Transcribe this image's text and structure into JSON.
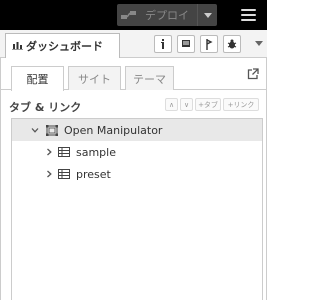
{
  "header": {
    "deploy_label": "デプロイ",
    "menu_icon": "hamburger-menu-icon"
  },
  "sidebar_tabs": {
    "dashboard_label": "ダッシュボード",
    "icons": [
      "info-icon",
      "book-icon",
      "debug-icon",
      "bug-icon",
      "chart-icon"
    ]
  },
  "dashboard": {
    "subtabs": [
      "配置",
      "サイト",
      "テーマ"
    ],
    "section_title": "タブ & リンク",
    "buttons": {
      "collapse": "∧",
      "expand": "∨",
      "add_tab": "+タブ",
      "add_link": "+リンク"
    },
    "tree": [
      {
        "label": "Open Manipulator",
        "level": 0,
        "expanded": true,
        "icon": "tab-icon"
      },
      {
        "label": "sample",
        "level": 1,
        "expanded": false,
        "icon": "group-icon"
      },
      {
        "label": "preset",
        "level": 1,
        "expanded": false,
        "icon": "group-icon"
      }
    ]
  }
}
